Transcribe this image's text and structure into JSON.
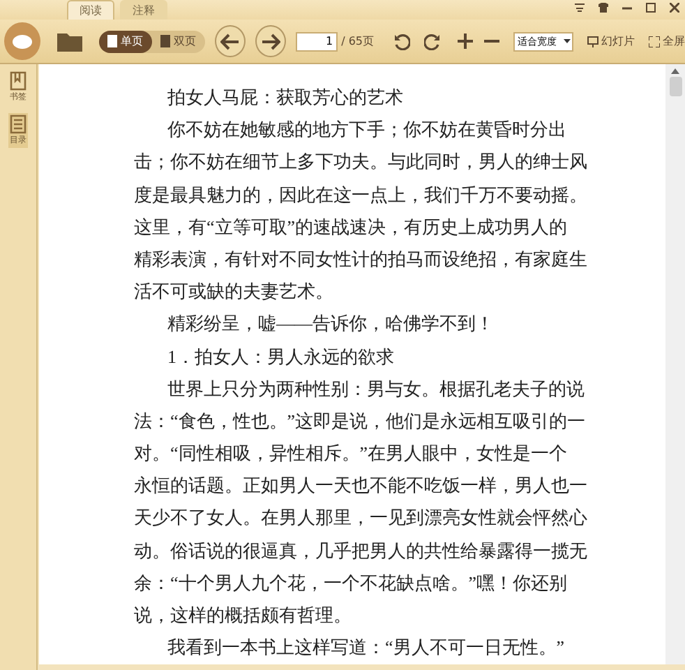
{
  "tabs": [
    {
      "label": "阅读",
      "selected": true
    },
    {
      "label": "注释",
      "selected": false
    }
  ],
  "toolbar": {
    "view_modes": [
      {
        "label": "单页",
        "selected": true
      },
      {
        "label": "双页",
        "selected": false
      }
    ],
    "page_input": "1",
    "page_total": "/ 65页",
    "zoom_select": "适合宽度",
    "slideshow": "幻灯片",
    "fullscreen": "全屏"
  },
  "sidebar": {
    "items": [
      {
        "label": "书签",
        "selected": false
      },
      {
        "label": "目录",
        "selected": true
      }
    ]
  },
  "document": {
    "paragraphs": [
      {
        "kind": "heading",
        "lines": [
          "拍女人马屁：获取芳心的艺术"
        ]
      },
      {
        "kind": "body",
        "lines": [
          "你不妨在她敏感的地方下手；你不妨在黄昏时分出",
          "击；你不妨在细节上多下功夫。与此同时，男人的绅士风",
          "度是最具魅力的，因此在这一点上，我们千万不要动摇。",
          "这里，有“立等可取”的速战速决，有历史上成功男人的",
          "精彩表演，有针对不同女性计的拍马而设绝招，有家庭生",
          "活不可或缺的夫妻艺术。"
        ]
      },
      {
        "kind": "body",
        "lines": [
          "精彩纷呈，嘘——告诉你，哈佛学不到！"
        ]
      },
      {
        "kind": "heading",
        "lines": [
          "1．拍女人：男人永远的欲求"
        ]
      },
      {
        "kind": "body",
        "lines": [
          "世界上只分为两种性别：男与女。根据孔老夫子的说",
          "法：“食色，性也。”这即是说，他们是永远相互吸引的一",
          "对。“同性相吸，异性相斥。”在男人眼中，女性是一个",
          "永恒的话题。正如男人一天也不能不吃饭一样，男人也一",
          "天少不了女人。在男人那里，一见到漂亮女性就会怦然心",
          "动。俗话说的很逼真，几乎把男人的共性给暴露得一揽无",
          "余：“十个男人九个花，一个不花缺点啥。”嘿！你还别",
          "说，这样的概括颇有哲理。"
        ]
      },
      {
        "kind": "body",
        "lines": [
          "我看到一本书上这样写道：“男人不可一日无性。”"
        ]
      }
    ]
  }
}
